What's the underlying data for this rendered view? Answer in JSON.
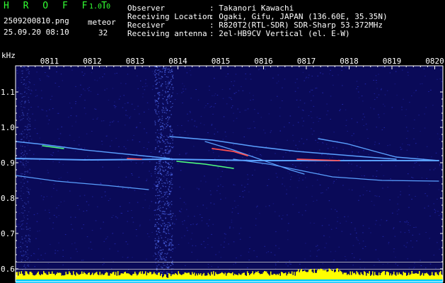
{
  "header": {
    "app_name": "H R O F F T",
    "version": "1.0.0",
    "filename": "2509200810.png",
    "datetime": "25.09.20 08:10",
    "meteor_label": "meteor",
    "meteor_count": "32",
    "info_labels": [
      "Observer",
      "Receiving Location",
      "Receiver",
      "Receiving antenna"
    ],
    "info_values": [
      ": Takanori Kawachi",
      ": Ogaki, Gifu, JAPAN (136.60E, 35.35N)",
      ": R820T2(RTL-SDR) SDR-Sharp 53.372MHz",
      ": 2el-HB9CV Vertical (el. E-W)"
    ]
  },
  "spectrogram": {
    "y_unit": "kHz",
    "y_ticks": [
      "1.1",
      "1.0",
      "0.9",
      "0.8",
      "0.7",
      "0.6"
    ],
    "time_ticks": [
      "0811",
      "0812",
      "0813",
      "0814",
      "0815",
      "0816",
      "0817",
      "0818",
      "0819",
      "0820"
    ],
    "colors": {
      "background": "#0a0a58",
      "noise": "#2a32c8",
      "trace": "#5aa0ff",
      "hot": "#ff5050",
      "warm": "#50ff80",
      "bar": "#ffff00",
      "bar_base": "#00c8ff"
    }
  }
}
